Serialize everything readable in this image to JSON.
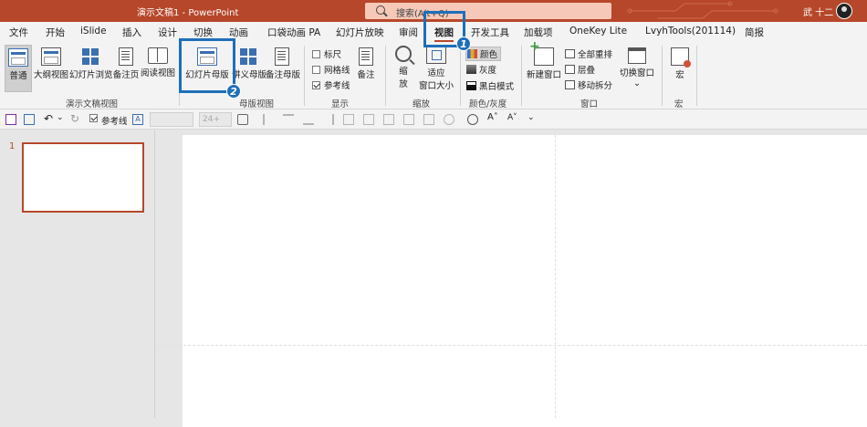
{
  "titlebar": {
    "title": "演示文稿1  -  PowerPoint",
    "search_placeholder": "搜索(Alt+Q)",
    "user": "武 十二",
    "accent": "#b7472a"
  },
  "tabs": [
    "文件",
    "开始",
    "iSlide",
    "插入",
    "设计",
    "切换",
    "动画",
    "口袋动画 PA",
    "幻灯片放映",
    "审阅",
    "视图",
    "开发工具",
    "加载项",
    "OneKey Lite",
    "LvyhTools(201114)",
    "简报"
  ],
  "active_tab": "视图",
  "ribbon": {
    "presentation_views": {
      "label": "演示文稿视图",
      "buttons": [
        "普通",
        "大纲视图",
        "幻灯片浏览",
        "备注页",
        "阅读视图"
      ]
    },
    "master_views": {
      "label": "母版视图",
      "buttons": [
        "幻灯片母版",
        "讲义母版",
        "备注母版"
      ]
    },
    "show": {
      "label": "显示",
      "checks": [
        {
          "label": "标尺",
          "checked": false
        },
        {
          "label": "网格线",
          "checked": false
        },
        {
          "label": "参考线",
          "checked": true
        }
      ],
      "notes_button": "备注"
    },
    "zoom": {
      "label": "缩放",
      "zoom_button": [
        "缩",
        "放"
      ],
      "fit_button": [
        "适应",
        "窗口大小"
      ]
    },
    "color": {
      "label": "颜色/灰度",
      "items": [
        "颜色",
        "灰度",
        "黑白模式"
      ]
    },
    "window": {
      "label": "窗口",
      "new_window": "新建窗口",
      "small": [
        "全部重排",
        "层叠",
        "移动拆分"
      ],
      "switch": "切换窗口"
    },
    "macros": {
      "label": "宏",
      "button": "宏"
    }
  },
  "annotations": {
    "badge1": "1",
    "badge2": "2",
    "color": "#1e6fb8"
  },
  "qat": {
    "guides_label": "参考线",
    "font_size": "24+"
  },
  "thumbnails": [
    {
      "number": "1"
    }
  ]
}
